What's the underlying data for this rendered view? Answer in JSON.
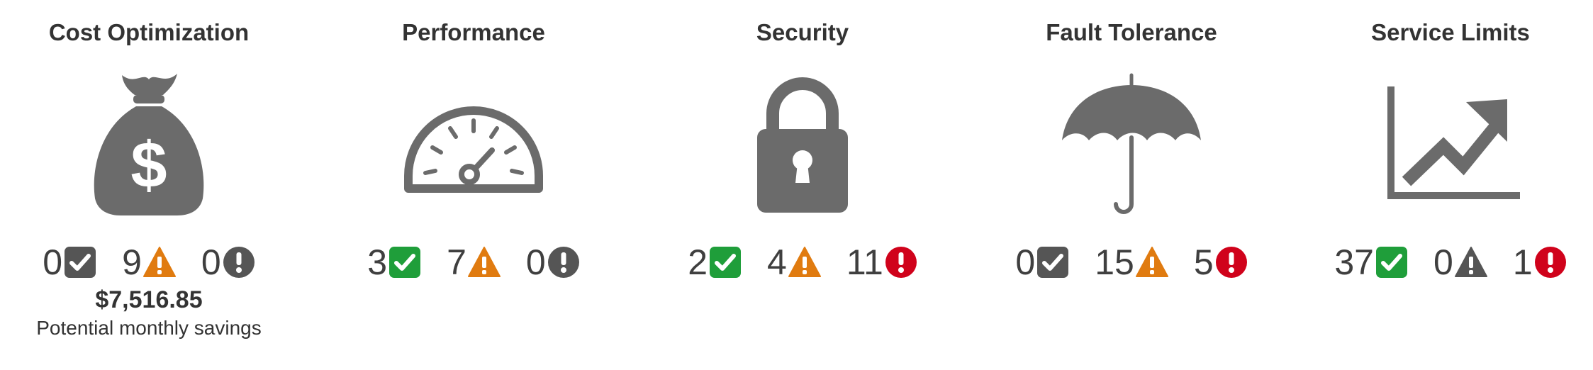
{
  "colors": {
    "icon_gray": "#6b6b6b",
    "ok_green": "#1f9e3a",
    "ok_gray": "#555555",
    "warn_orange": "#e07b10",
    "warn_gray": "#555555",
    "error_red": "#d0021b",
    "error_gray": "#555555"
  },
  "categories": [
    {
      "title": "Cost Optimization",
      "icon": "money-bag-icon",
      "counts": {
        "ok": "0",
        "warning": "9",
        "error": "0"
      },
      "active": {
        "ok": false,
        "warning": true,
        "error": false
      },
      "savings_amount": "$7,516.85",
      "savings_label": "Potential monthly savings"
    },
    {
      "title": "Performance",
      "icon": "speedometer-icon",
      "counts": {
        "ok": "3",
        "warning": "7",
        "error": "0"
      },
      "active": {
        "ok": true,
        "warning": true,
        "error": false
      }
    },
    {
      "title": "Security",
      "icon": "padlock-icon",
      "counts": {
        "ok": "2",
        "warning": "4",
        "error": "11"
      },
      "active": {
        "ok": true,
        "warning": true,
        "error": true
      }
    },
    {
      "title": "Fault Tolerance",
      "icon": "umbrella-icon",
      "counts": {
        "ok": "0",
        "warning": "15",
        "error": "5"
      },
      "active": {
        "ok": false,
        "warning": true,
        "error": true
      }
    },
    {
      "title": "Service Limits",
      "icon": "trend-chart-icon",
      "counts": {
        "ok": "37",
        "warning": "0",
        "error": "1"
      },
      "active": {
        "ok": true,
        "warning": false,
        "error": true
      }
    }
  ]
}
